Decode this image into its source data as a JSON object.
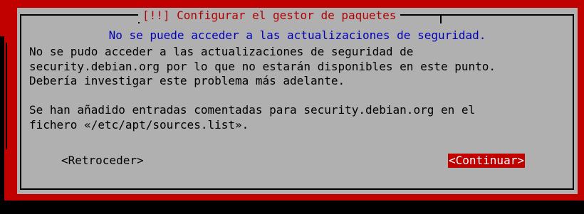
{
  "dialog": {
    "title": "[!!] Configurar el gestor de paquetes",
    "subtitle": "No se puede acceder a las actualizaciones de seguridad.",
    "message_lines": [
      "No se pudo acceder a las actualizaciones de seguridad de",
      "security.debian.org por lo que no estarán disponibles en este punto.",
      "Debería investigar este problema más adelante.",
      "",
      "Se han añadido entradas comentadas para security.debian.org en el",
      "fichero «/etc/apt/sources.list»."
    ],
    "buttons": {
      "back": "<Retroceder>",
      "continue": "<Continuar>"
    }
  },
  "colors": {
    "screen_background": "#c10000",
    "dialog_background": "#b0b0b0",
    "title_text": "#b00000",
    "subtitle_text": "#0000b8",
    "selected_button_bg": "#c10000",
    "selected_button_text": "#ffffff"
  }
}
